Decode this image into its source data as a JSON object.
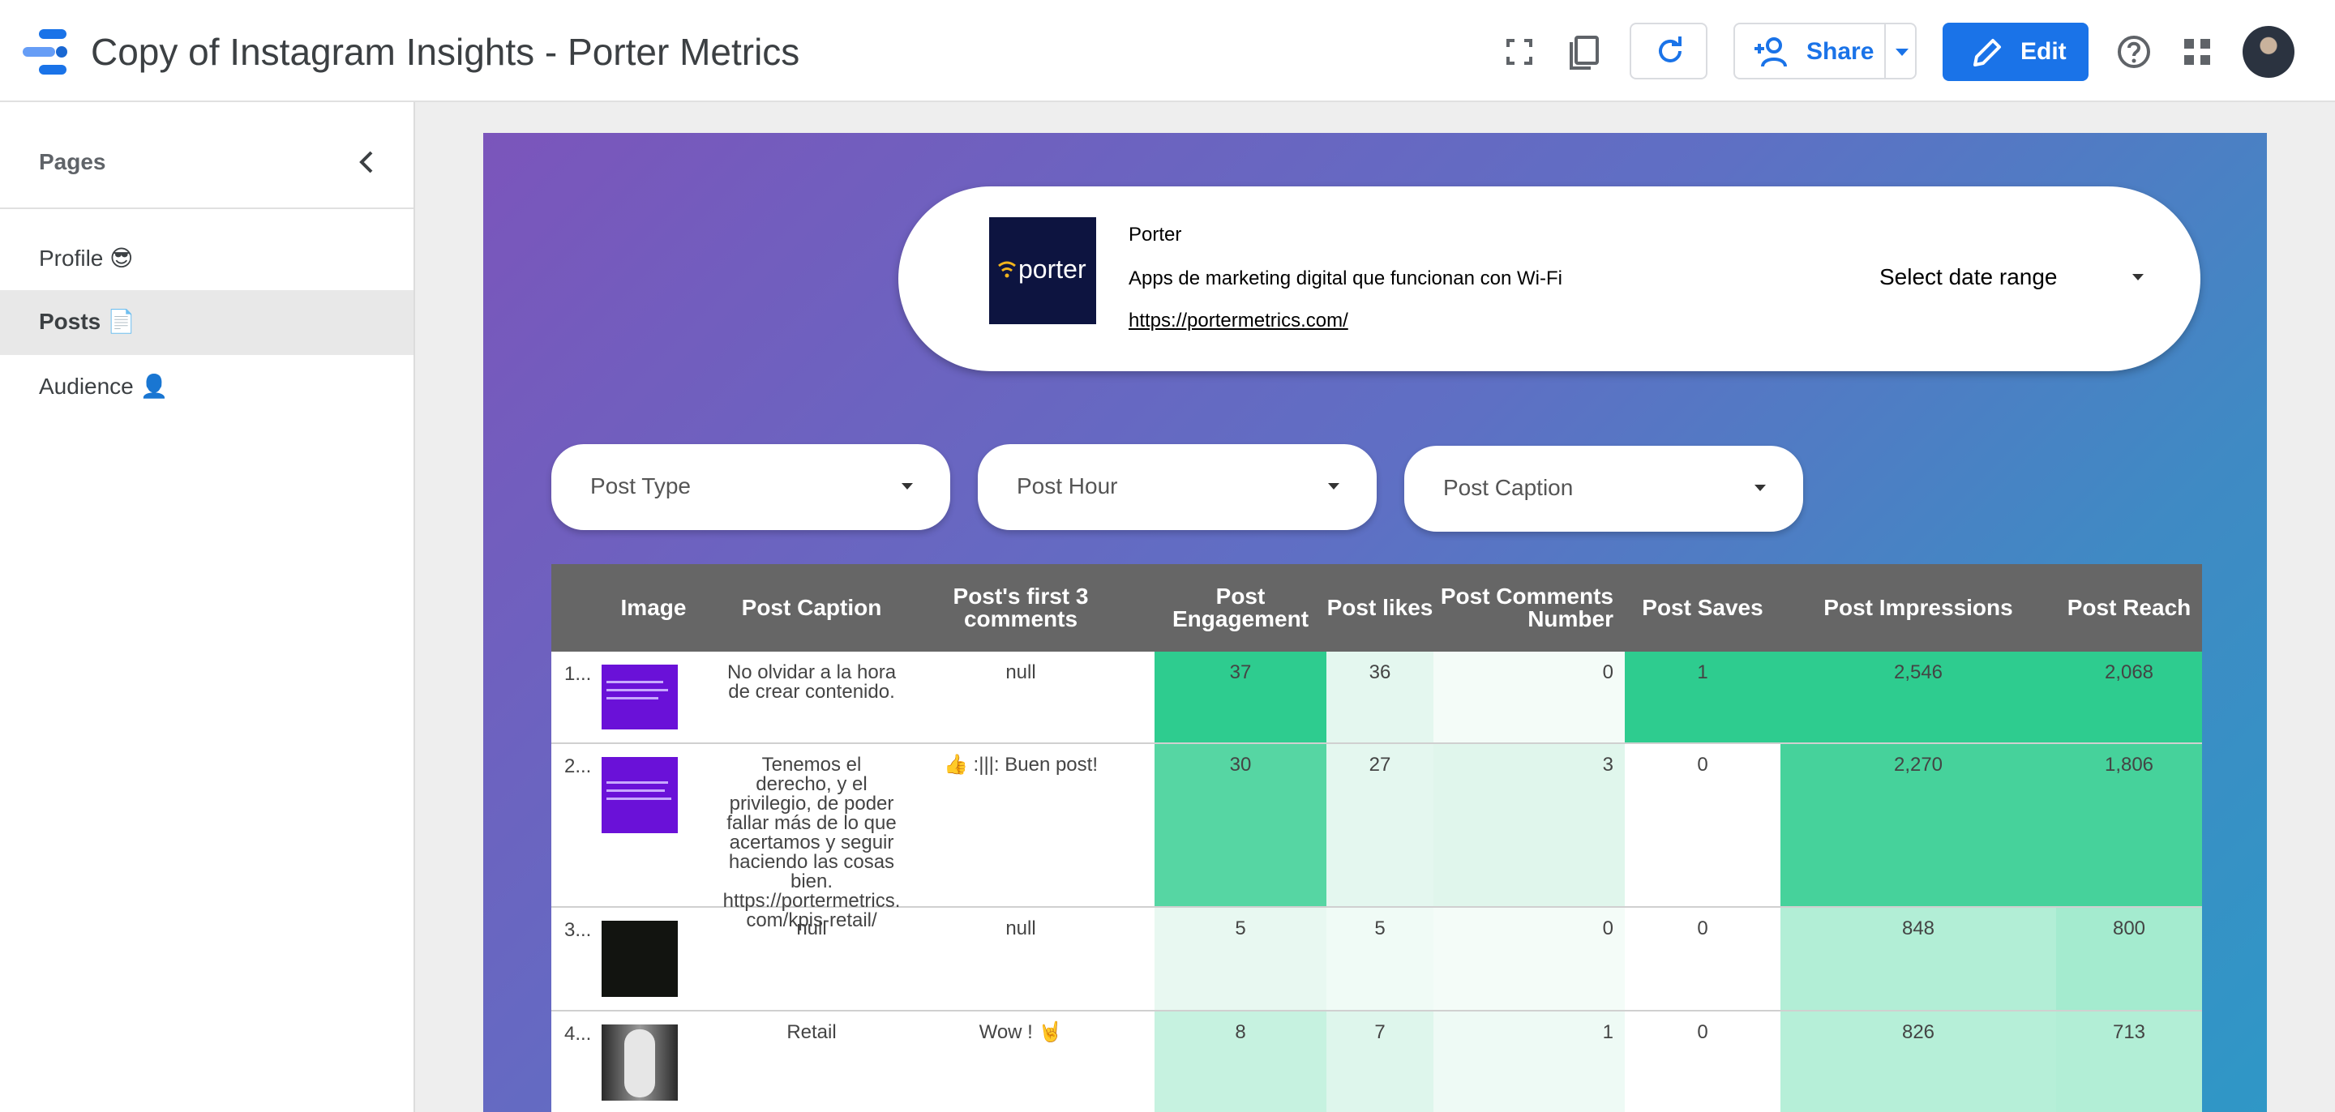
{
  "app": {
    "title": "Copy of Instagram Insights - Porter Metrics",
    "share_label": "Share",
    "edit_label": "Edit"
  },
  "sidebar": {
    "title": "Pages",
    "items": [
      {
        "label": "Profile 😎",
        "active": false
      },
      {
        "label": "Posts 📄",
        "active": true
      },
      {
        "label": "Audience 👤",
        "active": false
      }
    ]
  },
  "header": {
    "brand_logo_text": "porter",
    "name": "Porter",
    "description": "Apps de marketing digital que funcionan con Wi-Fi",
    "link": "https://portermetrics.com/",
    "date_range_label": "Select date range"
  },
  "filters": [
    {
      "label": "Post Type"
    },
    {
      "label": "Post Hour"
    },
    {
      "label": "Post Caption"
    }
  ],
  "table": {
    "columns": [
      "Image",
      "Post Caption",
      "Post's first 3 comments",
      "Post Engagement",
      "Post likes",
      "Post Comments Number",
      "Post Saves",
      "Post Impressions",
      "Post Reach"
    ],
    "rows": [
      {
        "num": "1...",
        "caption": "No olvidar a la hora de crear contenido.",
        "comments": "null",
        "engagement": "37",
        "likes": "36",
        "comments_number": "0",
        "saves": "1",
        "impressions": "2,546",
        "reach": "2,068",
        "thumb": "#6a11d8"
      },
      {
        "num": "2...",
        "caption": "Tenemos el derecho, y el privilegio, de poder fallar más de lo que acertamos y seguir haciendo las cosas bien. https://portermetrics.com/kpis-retail/",
        "comments": "👍 :|||: Buen post!",
        "engagement": "30",
        "likes": "27",
        "comments_number": "3",
        "saves": "0",
        "impressions": "2,270",
        "reach": "1,806",
        "thumb": "#6a11d8"
      },
      {
        "num": "3...",
        "caption": "null",
        "comments": "null",
        "engagement": "5",
        "likes": "5",
        "comments_number": "0",
        "saves": "0",
        "impressions": "848",
        "reach": "800",
        "thumb": "#121410"
      },
      {
        "num": "4...",
        "caption": "Retail",
        "comments": "Wow ! 🤘",
        "engagement": "8",
        "likes": "7",
        "comments_number": "1",
        "saves": "0",
        "impressions": "826",
        "reach": "713",
        "thumb": "#888888"
      }
    ]
  },
  "colors": {
    "accent": "#1a73e8",
    "header_bg": "#666666",
    "heat_high": "#2ecc8f",
    "heat_mid": "#56d6a3",
    "heat_low": "#b2eed6",
    "heat_min": "#e8f8f1"
  }
}
